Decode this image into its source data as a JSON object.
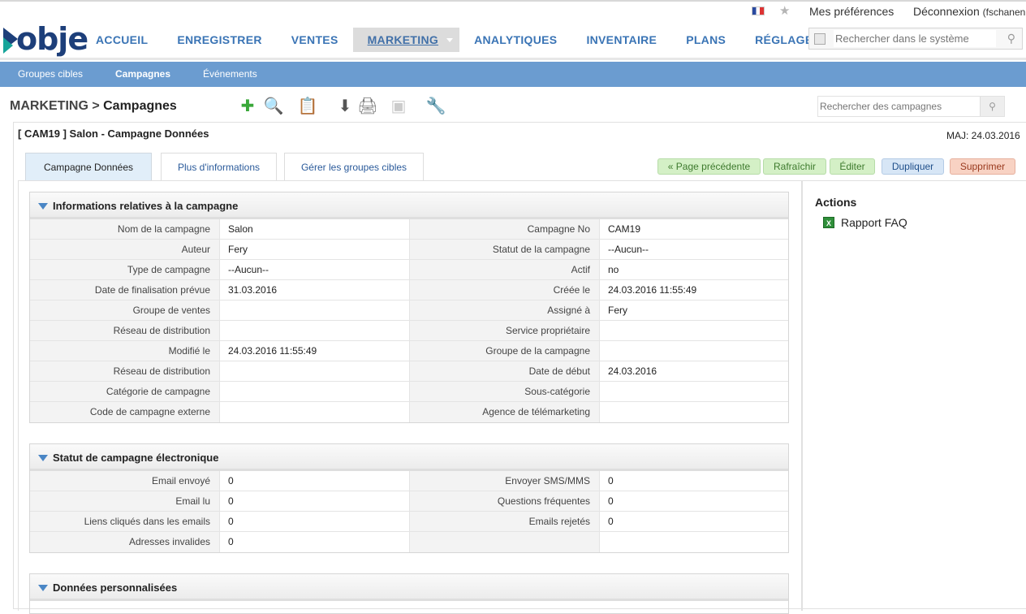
{
  "topbar": {
    "prefs": "Mes préférences",
    "logout": "Déconnexion",
    "user": "(fschanen"
  },
  "logo": {
    "text": "obje"
  },
  "nav": [
    {
      "label": "ACCUEIL"
    },
    {
      "label": "ENREGISTRER"
    },
    {
      "label": "VENTES"
    },
    {
      "label": "MARKETING",
      "active": true
    },
    {
      "label": "ANALYTIQUES"
    },
    {
      "label": "INVENTAIRE"
    },
    {
      "label": "PLANS"
    },
    {
      "label": "RÉGLAGES"
    }
  ],
  "global_search": {
    "placeholder": "Rechercher dans le système"
  },
  "subnav": [
    "Groupes cibles",
    "Campagnes",
    "Événements"
  ],
  "breadcrumb": {
    "module": "MARKETING",
    "sep": " > ",
    "page": "Campagnes"
  },
  "campaign_search": {
    "placeholder": "Rechercher des campagnes"
  },
  "record": {
    "title": "[ CAM19 ] Salon - Campagne Données",
    "updated": "MAJ: 24.03.2016"
  },
  "tabs": [
    "Campagne Données",
    "Plus d'informations",
    "Gérer les groupes cibles"
  ],
  "action_buttons": {
    "prev": "« Page précédente",
    "refresh": "Rafraîchir",
    "edit": "Éditer",
    "duplicate": "Dupliquer",
    "delete": "Supprimer"
  },
  "actions": {
    "title": "Actions",
    "faq": "Rapport FAQ"
  },
  "sections": {
    "info": {
      "title": "Informations relatives à la campagne",
      "rows": [
        [
          "Nom de la campagne",
          "Salon",
          "Campagne No",
          "CAM19"
        ],
        [
          "Auteur",
          "Fery",
          "Statut de la campagne",
          "--Aucun--"
        ],
        [
          "Type de campagne",
          "--Aucun--",
          "Actif",
          " no"
        ],
        [
          "Date de finalisation prévue",
          "31.03.2016",
          "Créée le",
          "24.03.2016 11:55:49"
        ],
        [
          "Groupe de ventes",
          "",
          "Assigné à",
          "  Fery"
        ],
        [
          "Réseau de distribution",
          "",
          "Service propriétaire",
          ""
        ],
        [
          "Modifié le",
          "24.03.2016 11:55:49",
          "Groupe de la campagne",
          ""
        ],
        [
          "Réseau de distribution",
          "",
          "Date de début",
          "24.03.2016"
        ],
        [
          "Catégorie de campagne",
          "",
          "Sous-catégorie",
          ""
        ],
        [
          "Code de campagne externe",
          "",
          "Agence de télémarketing",
          ""
        ]
      ]
    },
    "email": {
      "title": "Statut de campagne électronique",
      "rows": [
        [
          "Email envoyé",
          "0",
          "Envoyer SMS/MMS",
          "0"
        ],
        [
          "Email lu",
          "0",
          "Questions fréquentes",
          "0"
        ],
        [
          "Liens cliqués dans les emails",
          "0",
          "Emails rejetés",
          "0"
        ],
        [
          "Adresses invalides",
          "0",
          "",
          ""
        ]
      ]
    },
    "custom": {
      "title": "Données personnalisées"
    }
  }
}
